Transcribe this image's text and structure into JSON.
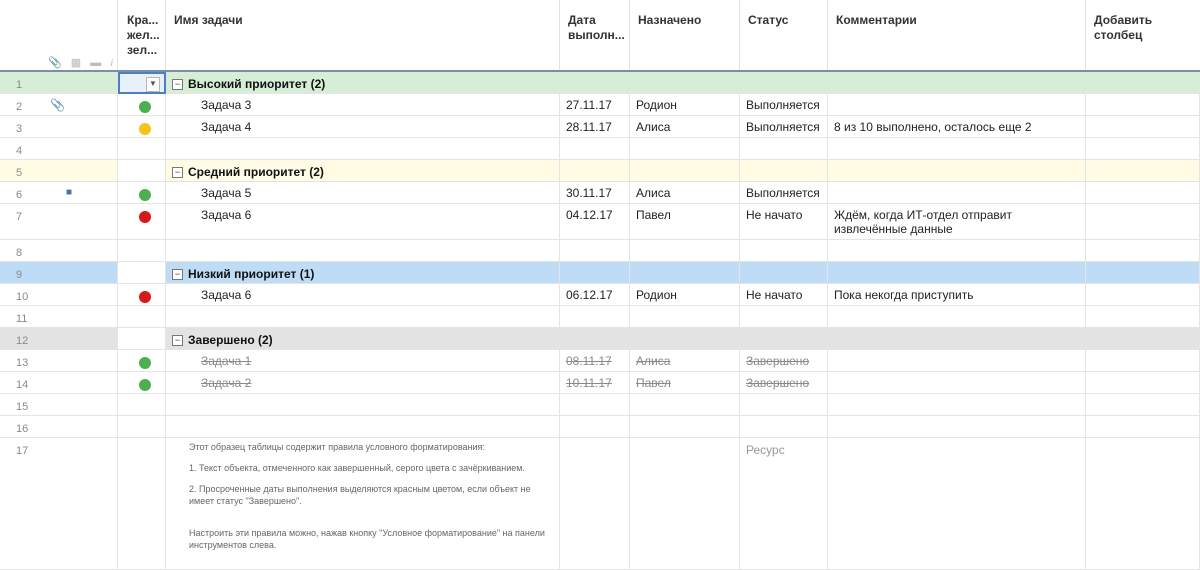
{
  "colors": {
    "green": "#4caf50",
    "yellow": "#f7c21a",
    "red": "#d7191c",
    "group_high": "#d5eed5",
    "group_mid": "#fffbe4",
    "group_low": "#bfdcf7",
    "group_done": "#e3e3e3"
  },
  "header": {
    "icons": [
      "paperclip-icon",
      "comment-icon",
      "proof-icon",
      "info-icon"
    ],
    "columns": {
      "rag": "Кра... жел... зел...",
      "task": "Имя задачи",
      "date": "Дата выполн...",
      "assigned": "Назначено",
      "status": "Статус",
      "comments": "Комментарии",
      "add": "Добавить столбец"
    }
  },
  "rows": [
    {
      "n": "1",
      "type": "group",
      "task": "Высокий приоритет (2)",
      "color": "group_high"
    },
    {
      "n": "2",
      "type": "task",
      "attach": "paperclip-icon",
      "rag": "green",
      "task": "Задача 3",
      "date": "27.11.17",
      "assigned": "Родион",
      "status": "Выполняется",
      "comment": ""
    },
    {
      "n": "3",
      "type": "task",
      "rag": "yellow",
      "task": "Задача 4",
      "date": "28.11.17",
      "assigned": "Алиса",
      "status": "Выполняется",
      "comment": "8 из 10 выполнено, осталось еще 2"
    },
    {
      "n": "4",
      "type": "empty"
    },
    {
      "n": "5",
      "type": "group",
      "task": "Средний приоритет (2)",
      "color": "group_mid"
    },
    {
      "n": "6",
      "type": "task",
      "attach": "comment-icon",
      "rag": "green",
      "task": "Задача 5",
      "date": "30.11.17",
      "assigned": "Алиса",
      "status": "Выполняется",
      "comment": ""
    },
    {
      "n": "7",
      "type": "task",
      "tall": true,
      "rag": "red",
      "task": "Задача 6",
      "date": "04.12.17",
      "assigned": "Павел",
      "status": "Не начато",
      "comment": "Ждём, когда ИТ-отдел отправит извлечённые данные"
    },
    {
      "n": "8",
      "type": "empty"
    },
    {
      "n": "9",
      "type": "group",
      "task": "Низкий приоритет (1)",
      "color": "group_low"
    },
    {
      "n": "10",
      "type": "task",
      "rag": "red",
      "task": "Задача 6",
      "date": "06.12.17",
      "assigned": "Родион",
      "status": "Не начато",
      "comment": "Пока некогда приступить"
    },
    {
      "n": "11",
      "type": "empty"
    },
    {
      "n": "12",
      "type": "group",
      "task": "Завершено (2)",
      "color": "group_done"
    },
    {
      "n": "13",
      "type": "task",
      "done": true,
      "rag": "green",
      "task": "Задача 1",
      "date": "08.11.17",
      "assigned": "Алиса",
      "status": "Завершено",
      "comment": ""
    },
    {
      "n": "14",
      "type": "task",
      "done": true,
      "rag": "green",
      "task": "Задача 2",
      "date": "10.11.17",
      "assigned": "Павел",
      "status": "Завершено",
      "comment": ""
    },
    {
      "n": "15",
      "type": "empty"
    },
    {
      "n": "16",
      "type": "empty"
    },
    {
      "n": "17",
      "type": "note"
    }
  ],
  "note": {
    "p1": "Этот образец таблицы содержит правила условного форматирования:",
    "p2": "1. Текст объекта, отмеченного как завершенный, серого цвета с зачёркиванием.",
    "p3": "2. Просроченные даты выполнения выделяются красным цветом, если объект не имеет статус \"Завершено\".",
    "p4": "Настроить эти правила можно, нажав кнопку \"Условное форматирование\" на панели инструментов слева.",
    "resource": "Ресурс"
  }
}
